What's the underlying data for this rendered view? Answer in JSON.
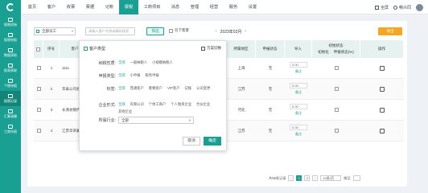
{
  "top_nav": {
    "items": [
      "首页",
      "客户",
      "收票",
      "票据",
      "记帐",
      "报税",
      "工商项目",
      "消息",
      "管理",
      "经营",
      "服务",
      "设置"
    ],
    "active": "报税"
  },
  "top_right": {
    "fullscreen": "全屏",
    "user": "畅众同"
  },
  "sidebar": {
    "items": [
      "报税初始",
      "报税申报",
      "数据获取",
      "报表获取",
      "个税申报",
      "报税记录",
      "汇算清缴",
      "工商年报"
    ],
    "active": "报税记录"
  },
  "toolbar": {
    "select_value": "全部员工",
    "search_placeholder": "请输入客户名称或编码搜索",
    "filter_label": "筛选",
    "check_label": "包下客客",
    "date": "2023年02月",
    "add_label": "导出"
  },
  "table": {
    "headers": [
      "序号",
      "客户名称",
      "",
      "",
      "",
      "",
      "",
      "",
      "所属地区",
      "申报状态",
      "导入",
      "初始状态",
      "",
      "操作"
    ],
    "sub_headers": [
      "初始化",
      "申报状态(%)"
    ],
    "rows": [
      {
        "no": "1",
        "name": "1111",
        "region": "上海",
        "status": "无",
        "select": "0.00",
        "note": "备注"
      },
      {
        "no": "2",
        "name": "华泰公司会计师事务",
        "region": "江苏",
        "status": "无",
        "select": "0.00",
        "note": "备注"
      },
      {
        "no": "3",
        "name": "长清县钢丙谷园食品",
        "region": "河北",
        "status": "无",
        "select": "0.00",
        "note": "备注"
      },
      {
        "no": "4",
        "name": "江苏华荣翼南新材",
        "region": "江苏",
        "status": "无",
        "select": "0.00",
        "note": "备注"
      }
    ]
  },
  "footer": {
    "total": "共58条记录",
    "pages": [
      "1",
      "2"
    ],
    "page_size": "10条/页",
    "goto": "跳至"
  },
  "popup": {
    "title": "客户类型",
    "save": "方案切换",
    "rows": [
      {
        "label": "纳税性质:",
        "options": [
          "全部",
          "一般纳税人",
          "小规模纳税人"
        ]
      },
      {
        "label": "申报类型:",
        "options": [
          "全部",
          "小申报",
          "税务申报"
        ]
      },
      {
        "label": "标签:",
        "options": [
          "全部",
          "普通客户",
          "重要客户",
          "VIP客户",
          "记账",
          "公司变更"
        ]
      },
      {
        "label": "企业形式:",
        "options": [
          "全部",
          "有限公司",
          "个体工商户",
          "个人独资企业",
          "合伙企业",
          "其他企业"
        ]
      }
    ],
    "industry_label": "所属行业:",
    "industry_value": "全部",
    "cancel": "取消",
    "ok": "确定"
  },
  "colors": {
    "brand": "#1a9f93",
    "accent": "#f5a623"
  }
}
